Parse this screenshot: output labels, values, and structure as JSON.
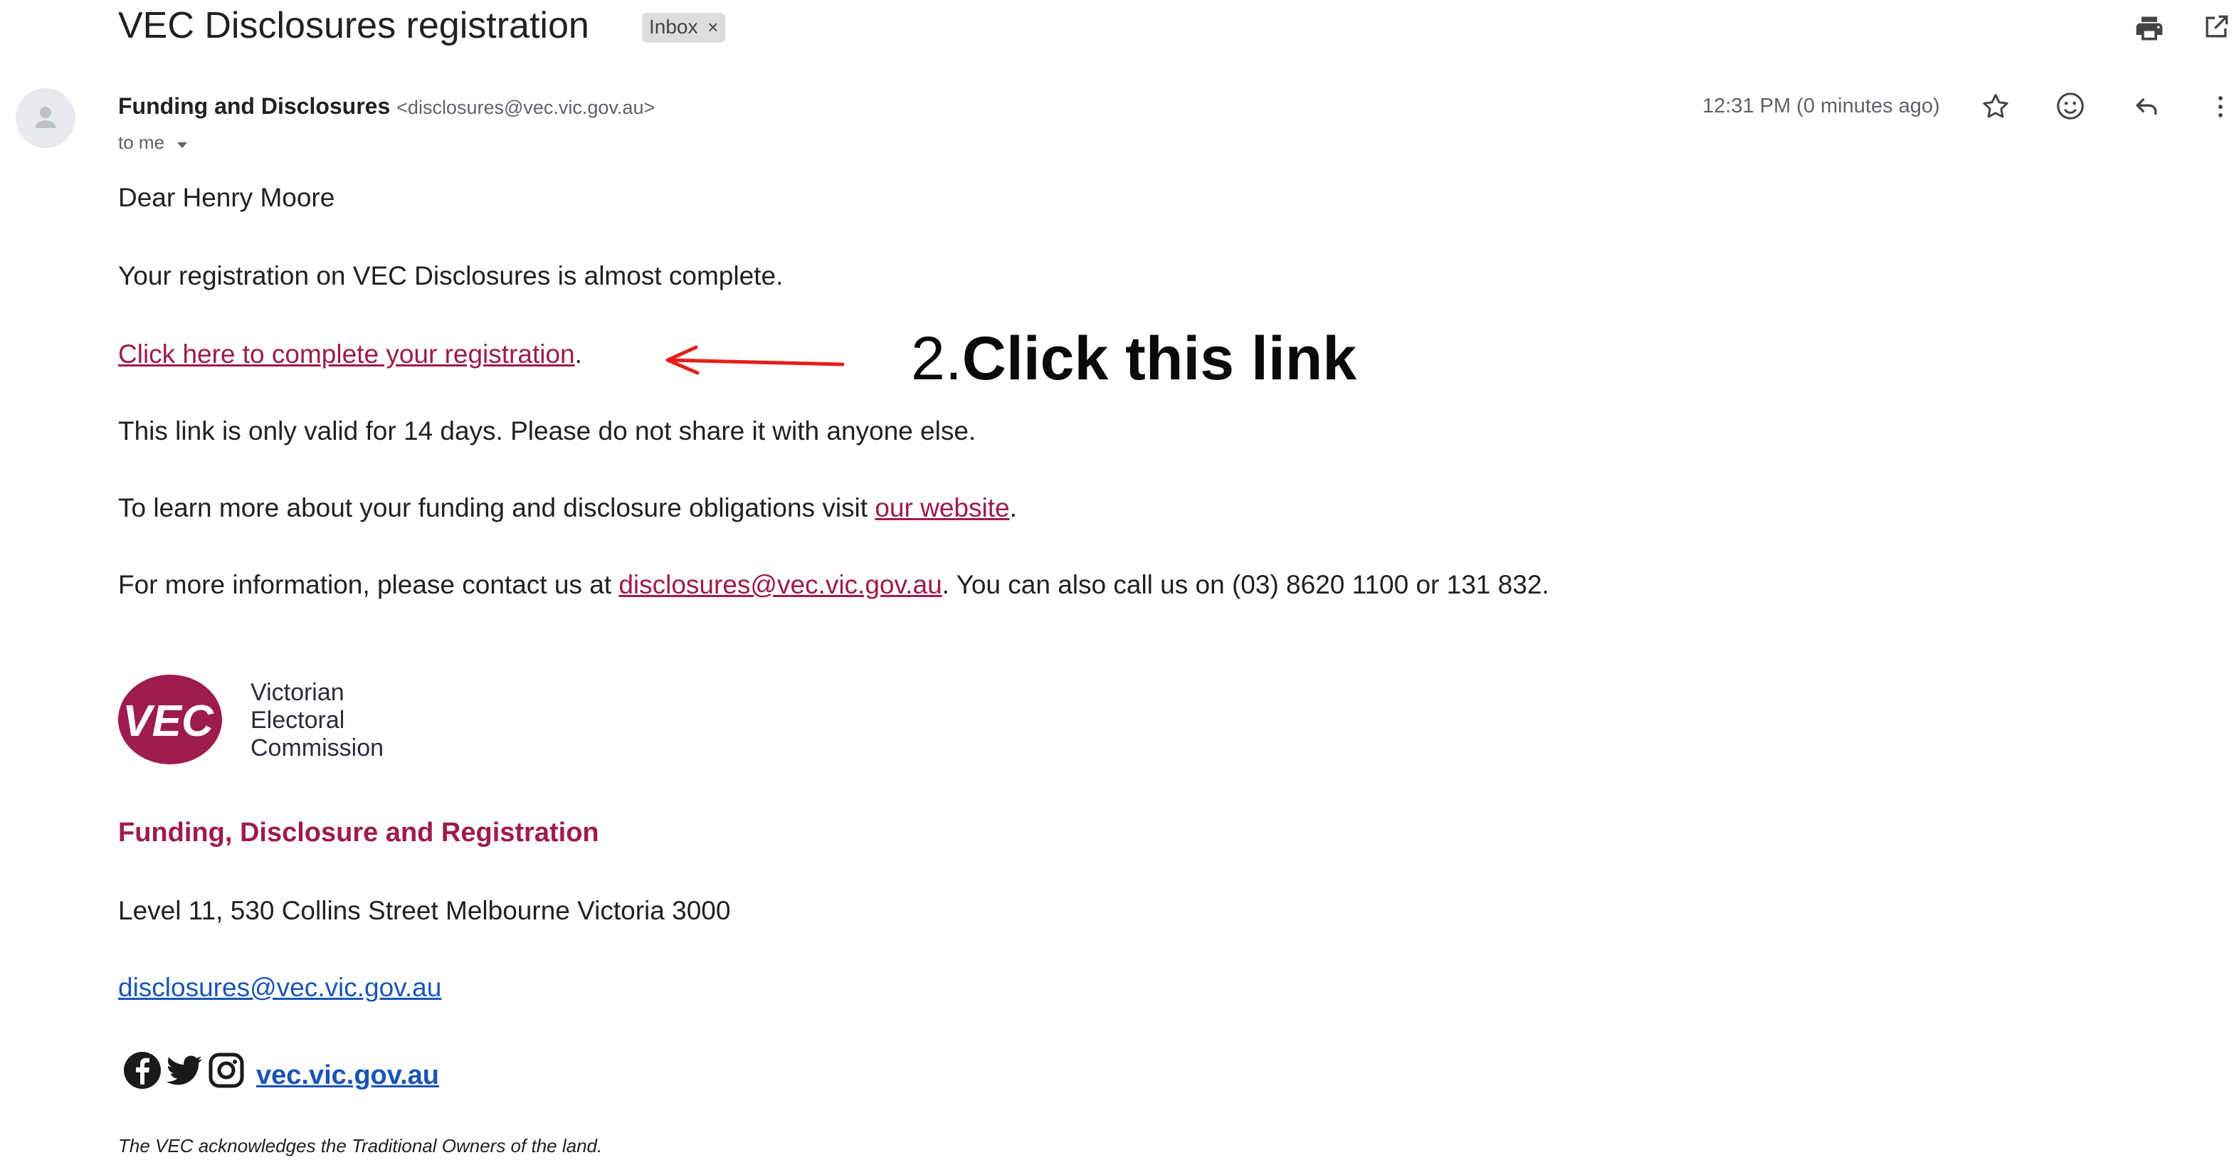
{
  "header": {
    "subject": "VEC Disclosures registration",
    "label_chip": "Inbox",
    "label_remove": "×",
    "print_icon": "print-icon",
    "popout_icon": "open-in-new-window-icon"
  },
  "message": {
    "sender_name": "Funding and Disclosures",
    "sender_email": "<disclosures@vec.vic.gov.au>",
    "recipient": "to me",
    "timestamp": "12:31 PM (0 minutes ago)",
    "actions": [
      "star-icon",
      "emoji-reaction-icon",
      "reply-icon",
      "more-options-icon"
    ]
  },
  "body": {
    "greeting": "Dear Henry Moore",
    "line1": "Your registration on VEC Disclosures is almost complete.",
    "registration_link": "Click here to complete your registration",
    "period": ".",
    "line3": "This link is only valid for 14 days. Please do not share it with anyone else.",
    "line4_prefix": "To learn more about your funding and disclosure obligations visit ",
    "website_link": "our website",
    "line5_prefix": "For more information, please contact us at ",
    "contact_link": "disclosures@vec.vic.gov.au",
    "line5_suffix": ". You can also call us on (03) 8620 1100 or 131 832."
  },
  "annotation": {
    "step_number": "2.",
    "instruction": "Click this link",
    "arrow_color": "#e3201b"
  },
  "signature": {
    "logo_mark": "VEC",
    "logo_line1": "Victorian",
    "logo_line2": "Electoral",
    "logo_line3": "Commission",
    "department": "Funding, Disclosure and Registration",
    "address": "Level 11, 530 Collins Street Melbourne Victoria 3000",
    "email": "disclosures@vec.vic.gov.au",
    "social_icons": [
      "facebook-icon",
      "twitter-icon",
      "instagram-icon"
    ],
    "website": "vec.vic.gov.au",
    "acknowledgement": "The VEC acknowledges the Traditional Owners of the land."
  },
  "colors": {
    "brand": "#9e1b4d",
    "link_blue": "#1a55b5",
    "text": "#202124",
    "muted": "#5f6368"
  }
}
